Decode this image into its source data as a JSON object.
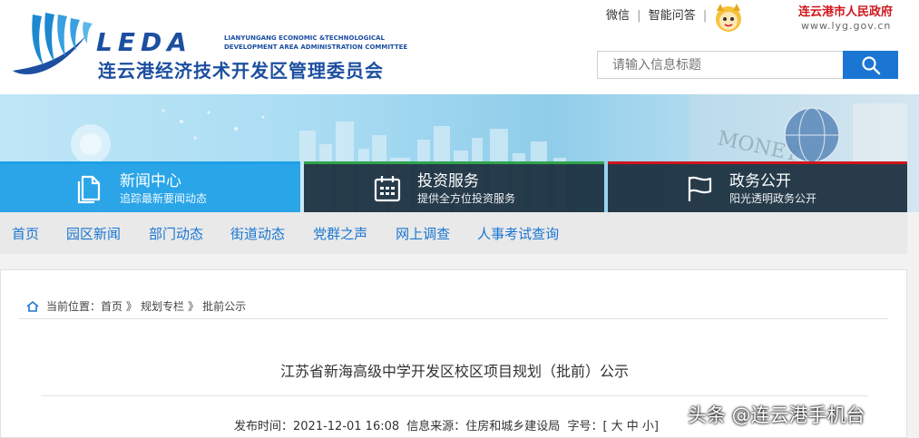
{
  "header": {
    "logo_text": "LEDA",
    "en_name_line1": "LIANYUNGANG ECONOMIC &TECHNOLOGICAL",
    "en_name_line2": "DEVELOPMENT AREA ADMINISTRATION COMMITTEE",
    "cn_name": "连云港经济技术开发区管理委员会",
    "links": [
      "微信",
      "智能问答"
    ],
    "gov_title": "连云港市人民政府",
    "gov_url": "www.lyg.gov.cn",
    "search_placeholder": "请输入信息标题"
  },
  "services": [
    {
      "title": "新闻中心",
      "subtitle": "追踪最新要闻动态",
      "icon": "document-icon"
    },
    {
      "title": "投资服务",
      "subtitle": "提供全方位投资服务",
      "icon": "calendar-icon"
    },
    {
      "title": "政务公开",
      "subtitle": "阳光透明政务公开",
      "icon": "flag-icon"
    }
  ],
  "nav": [
    "首页",
    "园区新闻",
    "部门动态",
    "街道动态",
    "党群之声",
    "网上调查",
    "人事考试查询"
  ],
  "breadcrumb": {
    "prefix": "当前位置：",
    "items": [
      "首页",
      "规划专栏",
      "批前公示"
    ],
    "separator": "》"
  },
  "article": {
    "title": "江苏省新海高级中学开发区校区项目规划（批前）公示",
    "publish_time": "发布时间：2021-12-01 16:08",
    "source": "信息来源：住房和城乡建设局",
    "font_size_label": "字号：[ 大 中 小]"
  },
  "watermark": "头条 @连云港手机台",
  "colors": {
    "brand_blue": "#1c4fa0",
    "link_blue": "#1a76d2",
    "gov_red": "#d0161c",
    "nav_bg": "#e9e9e9"
  }
}
